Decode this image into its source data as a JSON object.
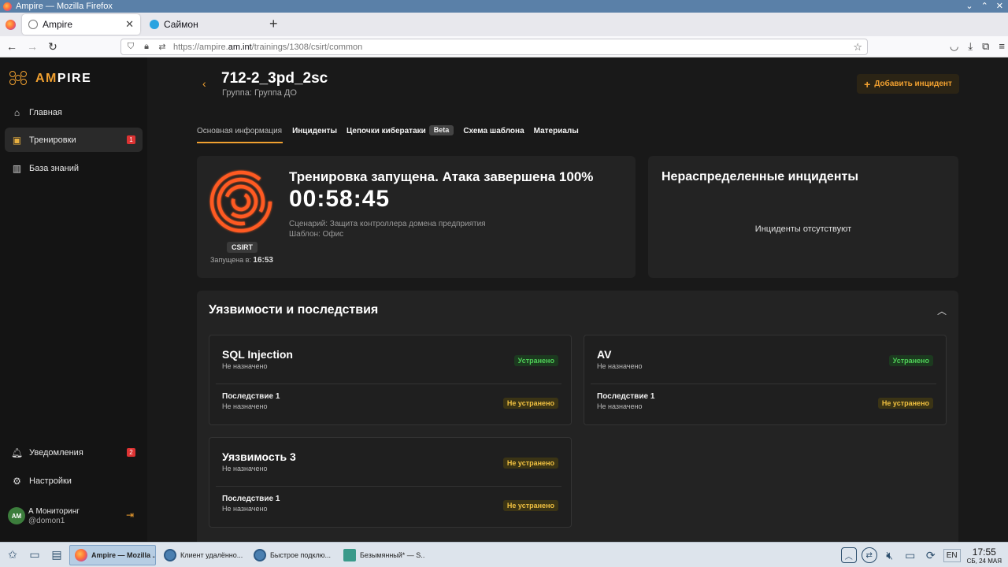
{
  "window": {
    "title": "Ampire — Mozilla Firefox"
  },
  "browser": {
    "tabs": [
      {
        "label": "Ampire",
        "active": true
      },
      {
        "label": "Саймон",
        "active": false
      }
    ],
    "url_prefix": "https://ampire.",
    "url_domain": "am.int",
    "url_path": "/trainings/1308/csirt/common"
  },
  "logo": {
    "accent": "AM",
    "rest": "PIRE"
  },
  "sidebar": {
    "items": [
      {
        "label": "Главная",
        "icon": "home-icon"
      },
      {
        "label": "Тренировки",
        "icon": "trainings-icon",
        "count": "1",
        "active": true
      },
      {
        "label": "База знаний",
        "icon": "book-icon"
      }
    ],
    "bottom_items": [
      {
        "label": "Уведомления",
        "icon": "bell-icon",
        "count": "2"
      },
      {
        "label": "Настройки",
        "icon": "gear-icon"
      }
    ],
    "user": {
      "initials": "AM",
      "name": "А Мониторинг",
      "login": "@domon1"
    }
  },
  "header": {
    "title": "712-2_3pd_2sc",
    "group": "Группа: Группа ДО",
    "add_button": "Добавить инцидент"
  },
  "page_tabs": [
    {
      "label": "Основная информация",
      "active": true
    },
    {
      "label": "Инциденты"
    },
    {
      "label": "Цепочки кибератаки",
      "badge": "Beta"
    },
    {
      "label": "Схема шаблона"
    },
    {
      "label": "Материалы"
    }
  ],
  "run": {
    "tag": "CSIRT",
    "started_label": "Запущена в:",
    "started_time": "16:53",
    "title": "Тренировка запущена. Атака завершена 100%",
    "timer": "00:58:45",
    "scenario": "Сценарий: Защита контроллера домена предприятия",
    "template": "Шаблон: Офис"
  },
  "unassigned": {
    "title": "Нераспределенные инциденты",
    "empty": "Инциденты отсутствуют"
  },
  "vulns": {
    "title": "Уязвимости и последствия",
    "cards": [
      {
        "name": "SQL Injection",
        "assignee": "Не назначено",
        "status": "Устранено",
        "consequence": {
          "name": "Последствие 1",
          "assignee": "Не назначено",
          "status": "Не устранено"
        }
      },
      {
        "name": "AV",
        "assignee": "Не назначено",
        "status": "Устранено",
        "consequence": {
          "name": "Последствие 1",
          "assignee": "Не назначено",
          "status": "Не устранено"
        }
      },
      {
        "name": "Уязвимость 3",
        "assignee": "Не назначено",
        "status": "Не устранено",
        "consequence": {
          "name": "Последствие 1",
          "assignee": "Не назначено",
          "status": "Не устранено"
        }
      }
    ]
  },
  "taskbar": {
    "tasks": [
      {
        "label": "Ampire — Mozilla ...",
        "active": true
      },
      {
        "label": "Клиент удалённо..."
      },
      {
        "label": "Быстрое подклю..."
      },
      {
        "label": "Безымянный* — S..."
      }
    ],
    "lang": "EN",
    "time": "17:55",
    "date": "СБ, 24 МАЯ"
  },
  "colors": {
    "accent": "#f0a030",
    "ok": "#4fcf58",
    "warn": "#f0c040",
    "ring": "#ff5a20"
  }
}
